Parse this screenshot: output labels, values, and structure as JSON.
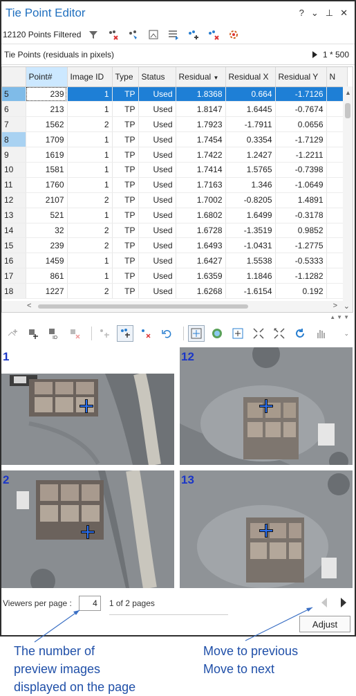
{
  "panel": {
    "title": "Tie Point Editor",
    "window_controls": [
      "?",
      "⌄",
      "⊥",
      "✕"
    ]
  },
  "toolbar1": {
    "filter_text": "12120 Points Filtered",
    "icons": [
      "filter-icon",
      "remove-filter-icon",
      "tie-point-filter-icon",
      "image-filter-icon",
      "table-options-icon",
      "add-tie-point-icon",
      "delete-tie-point-icon",
      "settings-icon"
    ]
  },
  "tiepoints": {
    "header_title": "Tie Points (residuals in pixels)",
    "ratio": "1 * 500",
    "columns": [
      "Point#",
      "Image ID",
      "Type",
      "Status",
      "Residual",
      "Residual X",
      "Residual Y",
      "N"
    ],
    "rows": [
      {
        "row": "5",
        "point": "239",
        "image_id": "1",
        "type": "TP",
        "status": "Used",
        "residual": "1.8368",
        "rx": "0.664",
        "ry": "-1.7126"
      },
      {
        "row": "6",
        "point": "213",
        "image_id": "1",
        "type": "TP",
        "status": "Used",
        "residual": "1.8147",
        "rx": "1.6445",
        "ry": "-0.7674"
      },
      {
        "row": "7",
        "point": "1562",
        "image_id": "2",
        "type": "TP",
        "status": "Used",
        "residual": "1.7923",
        "rx": "-1.7911",
        "ry": "0.0656"
      },
      {
        "row": "8",
        "point": "1709",
        "image_id": "1",
        "type": "TP",
        "status": "Used",
        "residual": "1.7454",
        "rx": "0.3354",
        "ry": "-1.7129"
      },
      {
        "row": "9",
        "point": "1619",
        "image_id": "1",
        "type": "TP",
        "status": "Used",
        "residual": "1.7422",
        "rx": "1.2427",
        "ry": "-1.2211"
      },
      {
        "row": "10",
        "point": "1581",
        "image_id": "1",
        "type": "TP",
        "status": "Used",
        "residual": "1.7414",
        "rx": "1.5765",
        "ry": "-0.7398"
      },
      {
        "row": "11",
        "point": "1760",
        "image_id": "1",
        "type": "TP",
        "status": "Used",
        "residual": "1.7163",
        "rx": "1.346",
        "ry": "-1.0649"
      },
      {
        "row": "12",
        "point": "2107",
        "image_id": "2",
        "type": "TP",
        "status": "Used",
        "residual": "1.7002",
        "rx": "-0.8205",
        "ry": "1.4891"
      },
      {
        "row": "13",
        "point": "521",
        "image_id": "1",
        "type": "TP",
        "status": "Used",
        "residual": "1.6802",
        "rx": "1.6499",
        "ry": "-0.3178"
      },
      {
        "row": "14",
        "point": "32",
        "image_id": "2",
        "type": "TP",
        "status": "Used",
        "residual": "1.6728",
        "rx": "-1.3519",
        "ry": "0.9852"
      },
      {
        "row": "15",
        "point": "239",
        "image_id": "2",
        "type": "TP",
        "status": "Used",
        "residual": "1.6493",
        "rx": "-1.0431",
        "ry": "-1.2775"
      },
      {
        "row": "16",
        "point": "1459",
        "image_id": "1",
        "type": "TP",
        "status": "Used",
        "residual": "1.6427",
        "rx": "1.5538",
        "ry": "-0.5333"
      },
      {
        "row": "17",
        "point": "861",
        "image_id": "1",
        "type": "TP",
        "status": "Used",
        "residual": "1.6359",
        "rx": "1.1846",
        "ry": "-1.1282"
      },
      {
        "row": "18",
        "point": "1227",
        "image_id": "2",
        "type": "TP",
        "status": "Used",
        "residual": "1.6268",
        "rx": "-1.6154",
        "ry": "0.192"
      }
    ]
  },
  "viewers": [
    {
      "label": "1"
    },
    {
      "label": "12"
    },
    {
      "label": "2"
    },
    {
      "label": "13"
    }
  ],
  "pager": {
    "label": "Viewers per page :",
    "value": "4",
    "count": "1 of 2 pages",
    "adjust_label": "Adjust"
  },
  "annotations": {
    "left_lines": [
      "The number of",
      "preview images",
      "displayed on the page"
    ],
    "right_lines": [
      "Move to previous",
      "Move to next"
    ]
  },
  "colors": {
    "title_blue": "#1f6fbf",
    "selection_blue": "#1e7fd6",
    "viewer_label": "#1b36c7",
    "annotation": "#1f4fa8"
  }
}
